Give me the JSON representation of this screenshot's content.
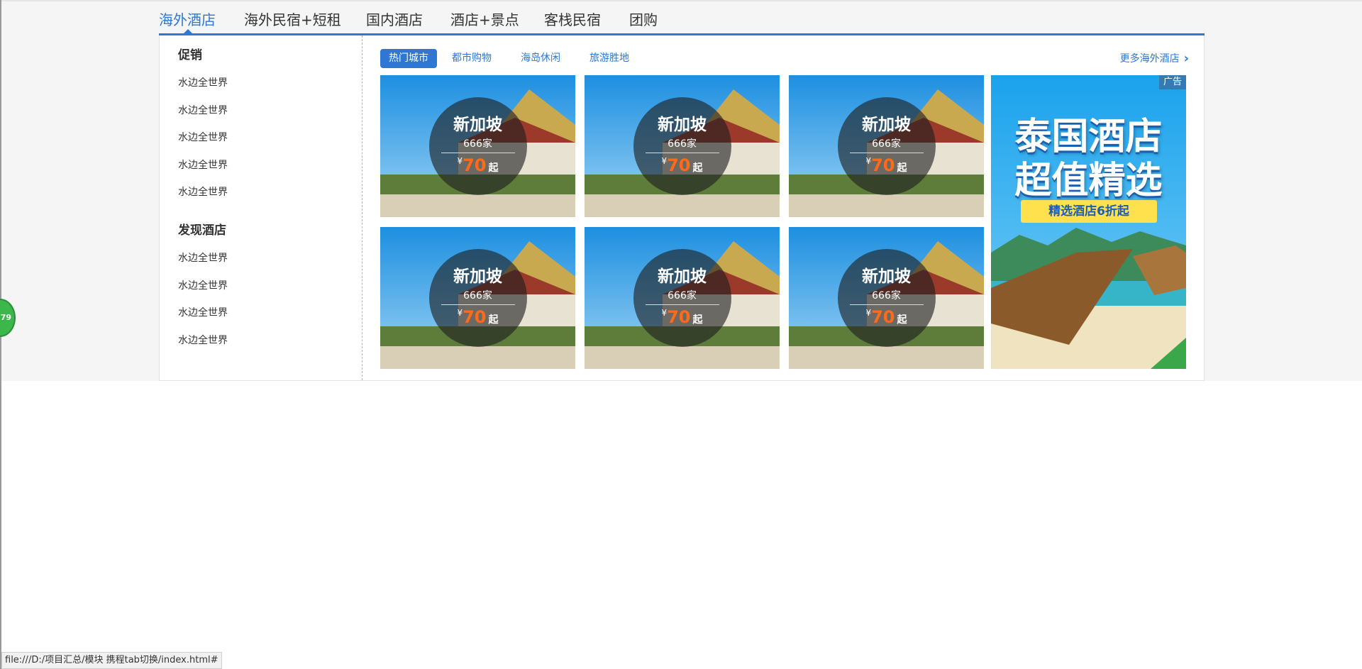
{
  "tabs": [
    {
      "label": "海外酒店",
      "active": true
    },
    {
      "label": "海外民宿+短租",
      "active": false
    },
    {
      "label": "国内酒店",
      "active": false
    },
    {
      "label": "酒店+景点",
      "active": false
    },
    {
      "label": "客栈民宿",
      "active": false
    },
    {
      "label": "团购",
      "active": false
    }
  ],
  "sidebar": {
    "sections": [
      {
        "title": "促销",
        "links": [
          "水边全世界",
          "水边全世界",
          "水边全世界",
          "水边全世界",
          "水边全世界"
        ]
      },
      {
        "title": "发现酒店",
        "links": [
          "水边全世界",
          "水边全世界",
          "水边全世界",
          "水边全世界"
        ]
      }
    ]
  },
  "subtabs": [
    {
      "label": "热门城市",
      "active": true
    },
    {
      "label": "都市购物",
      "active": false
    },
    {
      "label": "海岛休闲",
      "active": false
    },
    {
      "label": "旅游胜地",
      "active": false
    }
  ],
  "more_link": {
    "label": "更多海外酒店",
    "icon": "chevron-right-icon"
  },
  "cards": [
    {
      "city": "新加坡",
      "count": "666家",
      "currency": "¥",
      "price": "70",
      "suffix": "起"
    },
    {
      "city": "新加坡",
      "count": "666家",
      "currency": "¥",
      "price": "70",
      "suffix": "起"
    },
    {
      "city": "新加坡",
      "count": "666家",
      "currency": "¥",
      "price": "70",
      "suffix": "起"
    },
    {
      "city": "新加坡",
      "count": "666家",
      "currency": "¥",
      "price": "70",
      "suffix": "起"
    },
    {
      "city": "新加坡",
      "count": "666家",
      "currency": "¥",
      "price": "70",
      "suffix": "起"
    },
    {
      "city": "新加坡",
      "count": "666家",
      "currency": "¥",
      "price": "70",
      "suffix": "起"
    }
  ],
  "ad": {
    "badge": "广告",
    "line1": "泰国酒店",
    "line2": "超值精选",
    "ribbon": "精选酒店6折起"
  },
  "float_button": {
    "label": "79"
  },
  "status_bar": {
    "url": "file:///D:/项目汇总/模块 携程tab切换/index.html#"
  },
  "colors": {
    "accent": "#2e78d4",
    "price": "#ff6a1a",
    "background_band": "#f5f5f5"
  }
}
